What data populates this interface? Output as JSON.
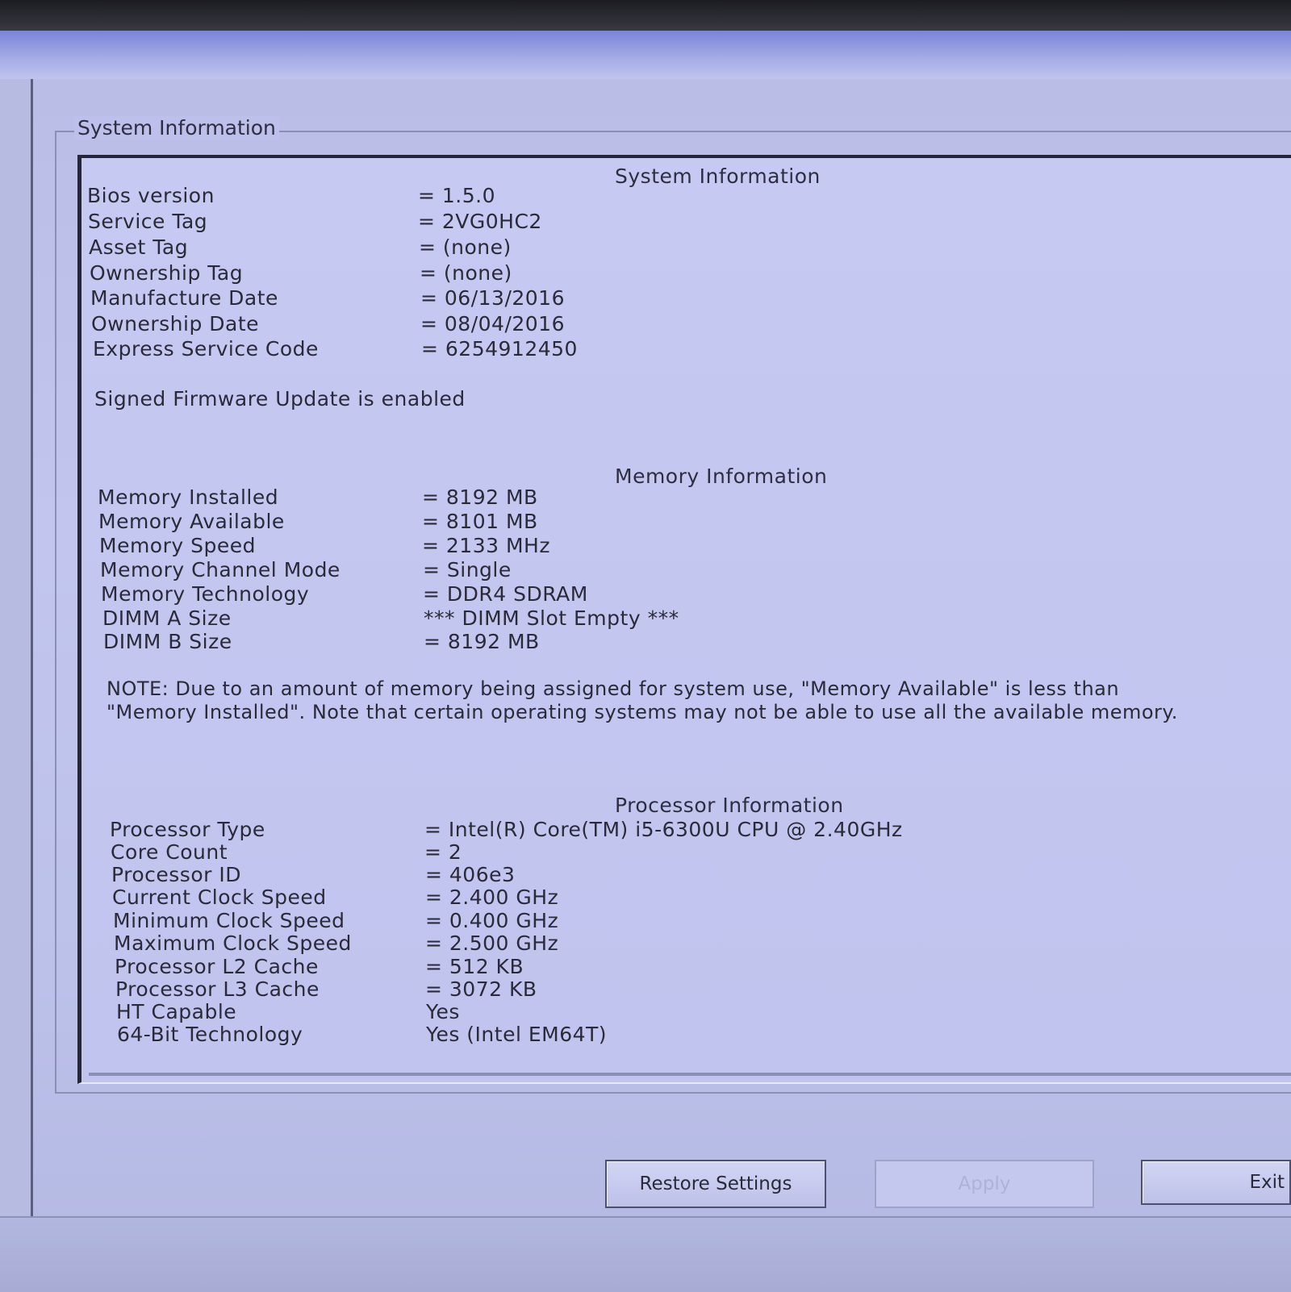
{
  "group_title": "System Information",
  "system": {
    "heading": "System Information",
    "rows": [
      {
        "label": "Bios version",
        "value": "= 1.5.0"
      },
      {
        "label": "Service Tag",
        "value": "= 2VG0HC2"
      },
      {
        "label": "Asset Tag",
        "value": "= (none)"
      },
      {
        "label": "Ownership Tag",
        "value": "= (none)"
      },
      {
        "label": "Manufacture Date",
        "value": "= 06/13/2016"
      },
      {
        "label": "Ownership Date",
        "value": "= 08/04/2016"
      },
      {
        "label": "Express Service Code",
        "value": "= 6254912450"
      }
    ],
    "firmware_note": "Signed Firmware Update is enabled"
  },
  "memory": {
    "heading": "Memory Information",
    "rows": [
      {
        "label": "Memory Installed",
        "value": "= 8192 MB"
      },
      {
        "label": "Memory Available",
        "value": "= 8101 MB"
      },
      {
        "label": "Memory Speed",
        "value": "= 2133 MHz"
      },
      {
        "label": "Memory Channel Mode",
        "value": "= Single"
      },
      {
        "label": "Memory Technology",
        "value": "= DDR4 SDRAM"
      },
      {
        "label": "DIMM A Size",
        "value": "*** DIMM Slot Empty ***"
      },
      {
        "label": "DIMM B Size",
        "value": "= 8192 MB"
      }
    ],
    "note": "NOTE: Due to an amount of memory being assigned for system use, \"Memory Available\" is less than \"Memory Installed\". Note that certain operating systems may not be able to use all the available memory."
  },
  "processor": {
    "heading": "Processor Information",
    "rows": [
      {
        "label": "Processor Type",
        "value": "= Intel(R) Core(TM) i5-6300U CPU @ 2.40GHz"
      },
      {
        "label": "Core Count",
        "value": "= 2"
      },
      {
        "label": "Processor ID",
        "value": "= 406e3"
      },
      {
        "label": "Current Clock Speed",
        "value": "= 2.400 GHz"
      },
      {
        "label": "Minimum Clock Speed",
        "value": "= 0.400 GHz"
      },
      {
        "label": "Maximum Clock Speed",
        "value": "= 2.500 GHz"
      },
      {
        "label": "Processor L2 Cache",
        "value": "= 512 KB"
      },
      {
        "label": "Processor L3 Cache",
        "value": "= 3072 KB"
      },
      {
        "label": "HT Capable",
        "value": "Yes"
      },
      {
        "label": "64-Bit Technology",
        "value": "Yes (Intel EM64T)"
      }
    ]
  },
  "buttons": {
    "restore": "Restore Settings",
    "apply": "Apply",
    "exit": "Exit"
  }
}
